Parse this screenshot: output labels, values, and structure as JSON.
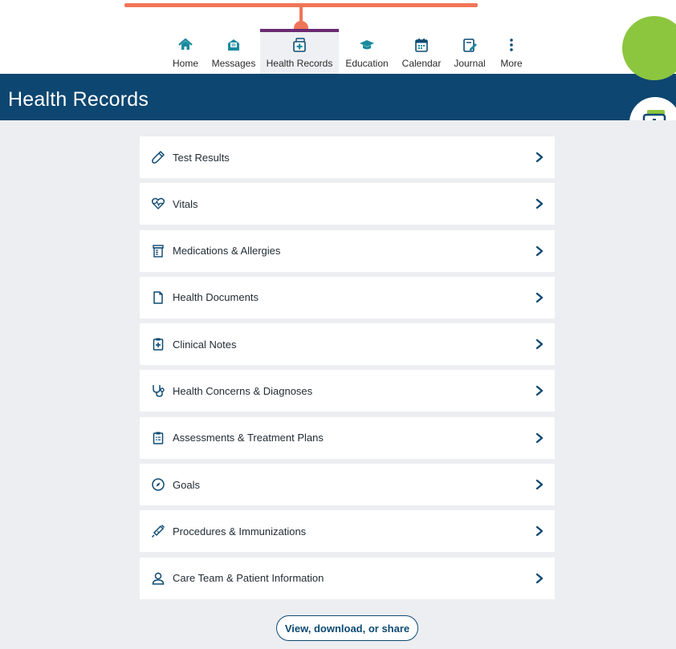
{
  "colors": {
    "accent": "#0d4a72",
    "header_band": "#0d4670",
    "active_tab_bar": "#6a2a72",
    "callout": "#f07558",
    "badge_green": "#8cc63f",
    "icon_teal": "#1a8a9e",
    "page_bg": "#eceef1"
  },
  "nav": {
    "items": [
      {
        "label": "Home",
        "icon": "house-icon",
        "active": false
      },
      {
        "label": "Messages",
        "icon": "envelope-icon",
        "active": false
      },
      {
        "label": "Health Records",
        "icon": "medical-folder-icon",
        "active": true
      },
      {
        "label": "Education",
        "icon": "graduation-cap-icon",
        "active": false
      },
      {
        "label": "Calendar",
        "icon": "calendar-icon",
        "active": false
      },
      {
        "label": "Journal",
        "icon": "journal-pencil-icon",
        "active": false
      },
      {
        "label": "More",
        "icon": "vertical-ellipsis-icon",
        "active": false
      }
    ]
  },
  "header": {
    "title": "Health Records",
    "badge_icon": "medical-folder-icon"
  },
  "records": {
    "items": [
      {
        "label": "Test Results",
        "icon": "test-tube-icon"
      },
      {
        "label": "Vitals",
        "icon": "heart-pulse-icon"
      },
      {
        "label": "Medications & Allergies",
        "icon": "pill-bottle-icon"
      },
      {
        "label": "Health Documents",
        "icon": "document-icon"
      },
      {
        "label": "Clinical Notes",
        "icon": "clipboard-plus-icon"
      },
      {
        "label": "Health Concerns & Diagnoses",
        "icon": "stethoscope-icon"
      },
      {
        "label": "Assessments & Treatment Plans",
        "icon": "clipboard-list-icon"
      },
      {
        "label": "Goals",
        "icon": "compass-icon"
      },
      {
        "label": "Procedures & Immunizations",
        "icon": "syringe-icon"
      },
      {
        "label": "Care Team & Patient Information",
        "icon": "person-icon"
      }
    ],
    "chevron_icon": "chevron-right-icon"
  },
  "share": {
    "label": "View, download, or share"
  }
}
